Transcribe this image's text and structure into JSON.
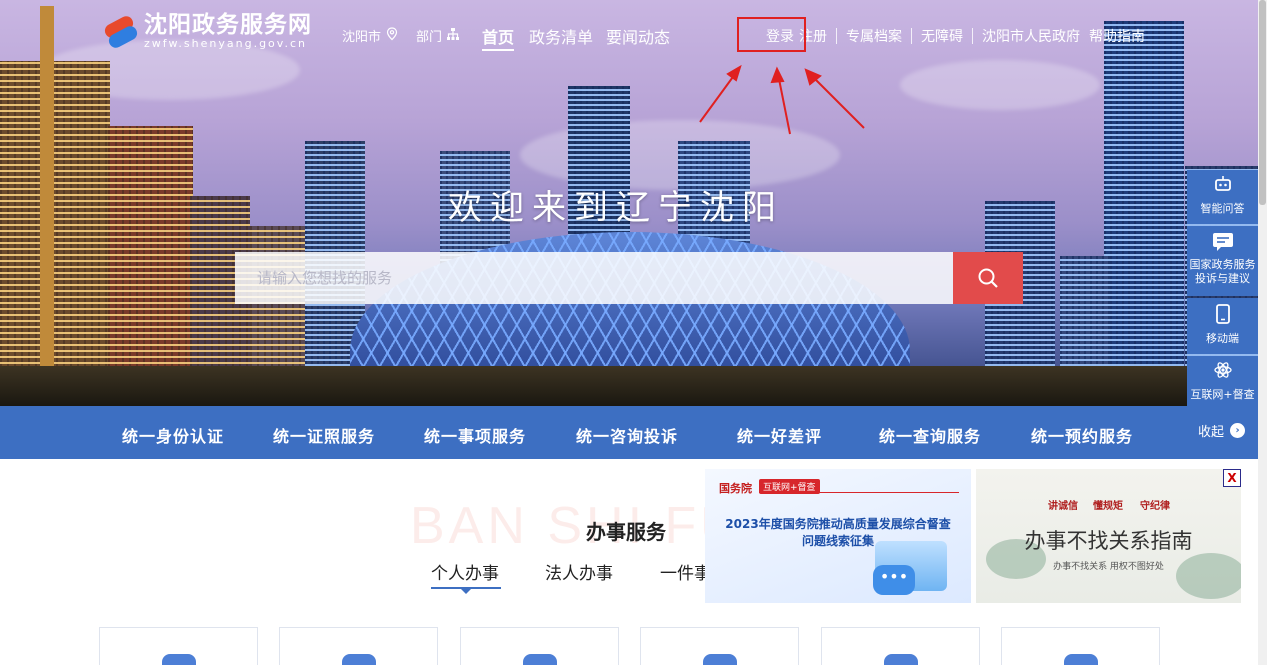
{
  "site": {
    "name_cn": "沈阳政务服务网",
    "name_en": "zwfw.shenyang.gov.cn"
  },
  "nav": {
    "city_label": "沈阳市",
    "dept_label": "部门",
    "home": "首页",
    "list": "政务清单",
    "news": "要闻动态"
  },
  "toplinks": {
    "login": "登录",
    "register": "注册",
    "archive": "专属档案",
    "accessible": "无障碍",
    "gov": "沈阳市人民政府",
    "help": "帮助指南"
  },
  "hero": {
    "welcome": "欢迎来到辽宁沈阳",
    "search_placeholder": "请输入您想找的服务"
  },
  "float_bar": {
    "items": [
      {
        "label": "智能问答",
        "icon": "robot-icon"
      },
      {
        "label": "国家政务服务投诉与建议",
        "icon": "message-icon"
      },
      {
        "label": "移动端",
        "icon": "mobile-icon"
      },
      {
        "label": "互联网+督查",
        "icon": "atom-icon"
      }
    ],
    "collapse": "收起"
  },
  "bluebar": {
    "items": [
      "统一身份认证",
      "统一证照服务",
      "统一事项服务",
      "统一咨询投诉",
      "统一好差评",
      "统一查询服务",
      "统一预约服务"
    ]
  },
  "services": {
    "bg_text": "BAN SHI FU",
    "title": "办事服务",
    "tabs": [
      "个人办事",
      "法人办事",
      "一件事"
    ]
  },
  "popup": {
    "left": {
      "tag1": "国务院",
      "tag2": "互联网+督查",
      "line1": "2023年度国务院推动高质量发展综合督查",
      "line2": "问题线索征集"
    },
    "right": {
      "seals": [
        "讲诚信",
        "懂规矩",
        "守纪律"
      ],
      "title": "办事不找关系指南",
      "subtitle": "办事不找关系 用权不图好处"
    },
    "close": "X"
  },
  "colors": {
    "brand_blue": "#3d6fc2",
    "search_red": "#e24b4b",
    "highlight_red": "#e02020"
  }
}
